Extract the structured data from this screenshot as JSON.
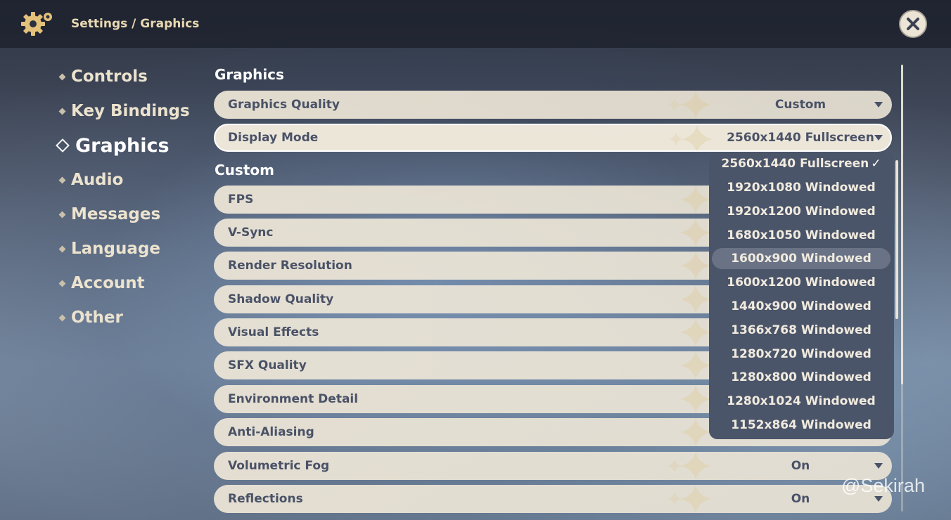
{
  "header": {
    "breadcrumb": "Settings / Graphics",
    "gear_icon": "gear-icon",
    "close_icon": "close-icon"
  },
  "nav": {
    "items": [
      {
        "label": "Controls",
        "active": false
      },
      {
        "label": "Key Bindings",
        "active": false
      },
      {
        "label": "Graphics",
        "active": true
      },
      {
        "label": "Audio",
        "active": false
      },
      {
        "label": "Messages",
        "active": false
      },
      {
        "label": "Language",
        "active": false
      },
      {
        "label": "Account",
        "active": false
      },
      {
        "label": "Other",
        "active": false
      }
    ]
  },
  "sections": {
    "graphics_title": "Graphics",
    "custom_title": "Custom"
  },
  "rows": [
    {
      "label": "Graphics Quality",
      "value": "Custom"
    },
    {
      "label": "Display Mode",
      "value": "2560x1440 Fullscreen"
    },
    {
      "label": "FPS",
      "value": ""
    },
    {
      "label": "V-Sync",
      "value": ""
    },
    {
      "label": "Render Resolution",
      "value": ""
    },
    {
      "label": "Shadow Quality",
      "value": ""
    },
    {
      "label": "Visual Effects",
      "value": ""
    },
    {
      "label": "SFX Quality",
      "value": ""
    },
    {
      "label": "Environment Detail",
      "value": ""
    },
    {
      "label": "Anti-Aliasing",
      "value": ""
    },
    {
      "label": "Volumetric Fog",
      "value": "On"
    },
    {
      "label": "Reflections",
      "value": "On"
    }
  ],
  "display_mode_dropdown": {
    "options": [
      "2560x1440 Fullscreen",
      "1920x1080 Windowed",
      "1920x1200 Windowed",
      "1680x1050 Windowed",
      "1600x900 Windowed",
      "1600x1200 Windowed",
      "1440x900 Windowed",
      "1366x768 Windowed",
      "1280x720 Windowed",
      "1280x800 Windowed",
      "1280x1024 Windowed",
      "1152x864 Windowed"
    ],
    "selected": "2560x1440 Fullscreen",
    "hovered": "1600x900 Windowed",
    "check_mark": "✓"
  },
  "watermark": "@Sekirah",
  "colors": {
    "row_bg": "#ece5d6",
    "row_text": "#4a5267",
    "dropdown_bg": "#4b5569",
    "accent_gold": "#e9d9b2"
  }
}
